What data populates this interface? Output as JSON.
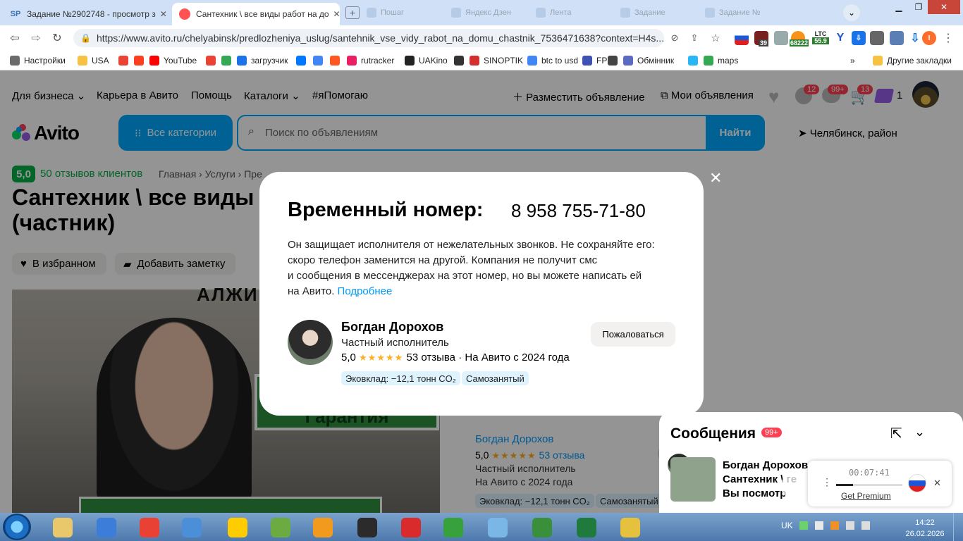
{
  "browser": {
    "tabs": [
      {
        "favicon": "SP",
        "title": "Задание №2902748 - просмотр з",
        "close": "✕"
      },
      {
        "favicon": "avito-icon",
        "title": "Сантехник \\ все виды работ на до",
        "close": "✕"
      }
    ],
    "new_tab": "+",
    "ghost_tabs": [
      "Пошаг",
      "Яндекс Дзен",
      "Лента",
      "Задание",
      "Задание №"
    ],
    "url": "https://www.avito.ru/chelyabinsk/predlozheniya_uslug/santehnik_vse_vidy_rabot_na_domu_chastnik_7536471638?context=H4s...",
    "ext_badges": {
      "shield": "39",
      "btc": "68222",
      "ltc_label": "LTC",
      "ltc": "55.9",
      "profile": "I"
    },
    "bookmarks": [
      {
        "label": "Настройки",
        "color": "#6b6b6b"
      },
      {
        "label": "USA",
        "color": "#f7c244"
      },
      {
        "label": "",
        "color": "#ea4335"
      },
      {
        "label": "",
        "color": "#fc3f1d"
      },
      {
        "label": "YouTube",
        "color": "#ff0000"
      },
      {
        "label": "",
        "color": "#ea4335"
      },
      {
        "label": "",
        "color": "#34a853"
      },
      {
        "label": "загрузчик",
        "color": "#1a73e8"
      },
      {
        "label": "",
        "color": "#0077ff"
      },
      {
        "label": "",
        "color": "#4285f4"
      },
      {
        "label": "",
        "color": "#ff5722"
      },
      {
        "label": "rutracker",
        "color": "#e91e63"
      },
      {
        "label": "UAKino",
        "color": "#222222"
      },
      {
        "label": "",
        "color": "#333333"
      },
      {
        "label": "SINOPTIK",
        "color": "#d32f2f"
      },
      {
        "label": "btc to usd",
        "color": "#4285f4"
      },
      {
        "label": "FP",
        "color": "#3f51b5"
      },
      {
        "label": "",
        "color": "#444444"
      },
      {
        "label": "Обмінник",
        "color": "#5c6bc0"
      },
      {
        "label": "",
        "color": "#29b6f6"
      },
      {
        "label": "maps",
        "color": "#34a853"
      }
    ],
    "more_bookmarks": "»",
    "other_bookmarks": "Другие закладки"
  },
  "avito": {
    "nav": [
      "Для бизнеса",
      "Карьера в Авито",
      "Помощь",
      "Каталоги",
      "#яПомогаю"
    ],
    "post_ad": "Разместить объявление",
    "my_ads": "Мои объявления",
    "counts": {
      "notifications": "12",
      "messages": "99+",
      "cart": "13",
      "promo": "1"
    },
    "logo": "Avito",
    "all_categories": "Все категории",
    "search_placeholder": "Поиск по объявлениям",
    "find": "Найти",
    "location": "Челябинск, район",
    "rating_badge": "5,0",
    "reviews_link": "50 отзывов клиентов",
    "breadcrumbs": "Главная › Услуги › Пре",
    "title_line1": "Сантехник \\ все виды",
    "title_line2": "(частник)",
    "favorite": "В избранном",
    "add_note": "Добавить заметку",
    "photo_text_top": "АЛЖИ",
    "photo_sign": "Гарантия",
    "seller": {
      "name": "Богдан Дорохов",
      "rating": "5,0",
      "stars": "★★★★★",
      "reviews": "53 отзыва",
      "type": "Частный исполнитель",
      "since": "На Авито с 2024 года",
      "eco": "Эковклад: −12,1 тонн CO₂",
      "selfemployed": "Самозанятый"
    }
  },
  "modal": {
    "close": "✕",
    "title": "Временный номер:",
    "phone": "8 958 755-71-80",
    "text_1": "Он защищает исполнителя от нежелательных звонков. Не сохраняйте его:",
    "text_2": "скоро телефон заменится на другой. Компания не получит смс",
    "text_3": "и сообщения в мессенджерах на этот номер, но вы можете написать ей",
    "text_4": "на Авито.",
    "more_link": "Подробнее",
    "name": "Богдан Дорохов",
    "role": "Частный исполнитель",
    "rating": "5,0",
    "stars": "★★★★★",
    "reviews": "53 отзыва",
    "since": "· На Авито с 2024 года",
    "eco": "Эковклад: −12,1 тонн CO₂",
    "selfemployed": "Самозанятый",
    "complain": "Пожаловаться"
  },
  "messages": {
    "title": "Сообщения",
    "badge": "99+",
    "line1": "Богдан Дорохов",
    "line2": "Сантехник \\ ге",
    "line3": "Вы посмотр"
  },
  "recorder": {
    "time": "00:07:41",
    "cta": "Get Premium"
  },
  "taskbar": {
    "lang": "UK",
    "time": "14:22",
    "date": "26.02.2026",
    "apps": [
      {
        "name": "explorer-icon",
        "color": "#e8c86a"
      },
      {
        "name": "shield-app-icon",
        "color": "#3b7dd8"
      },
      {
        "name": "chrome-icon",
        "color": "#e94235"
      },
      {
        "name": "globe-app-icon",
        "color": "#4a8fd8"
      },
      {
        "name": "yandex-icon",
        "color": "#ffcc00"
      },
      {
        "name": "spreadsheet-app-icon",
        "color": "#6bab42"
      },
      {
        "name": "media-player-icon",
        "color": "#f29a1e"
      },
      {
        "name": "clock-app-icon",
        "color": "#2b2b2b"
      },
      {
        "name": "app-64-icon",
        "color": "#d92b2b"
      },
      {
        "name": "chart-app-icon",
        "color": "#37a13b"
      },
      {
        "name": "notes-app-icon",
        "color": "#7ab7e6"
      },
      {
        "name": "terminal-app-icon",
        "color": "#3a8f3a"
      },
      {
        "name": "excel-icon",
        "color": "#1f7a3e"
      },
      {
        "name": "calendar-app-icon",
        "color": "#e5c13d"
      }
    ]
  }
}
